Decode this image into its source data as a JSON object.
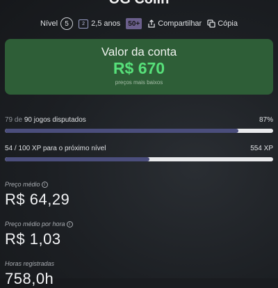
{
  "profile": {
    "name": "OG Colin",
    "level_label": "Nível",
    "level_value": "5",
    "years_icon_text": "2",
    "years": "2,5 anos",
    "badge": "50+",
    "share_label": "Compartilhar",
    "copy_label": "Cópia"
  },
  "account_value": {
    "title": "Valor da conta",
    "amount": "R$ 670",
    "subtitle": "preços mais baixos",
    "colors": {
      "card": "#2e5e37",
      "amount": "#57e07a"
    }
  },
  "games_progress": {
    "played": "79",
    "of_label": "de",
    "total": "90",
    "suffix": "jogos disputados",
    "percent_label": "87%",
    "fraction": 0.87
  },
  "xp_progress": {
    "label": "54 / 100 XP para o próximo nível",
    "right_label": "554 XP",
    "fraction": 0.54
  },
  "stats": {
    "avg_price_label": "Preço médio",
    "avg_price_value": "R$ 64,29",
    "avg_hour_label": "Preço médio por hora",
    "avg_hour_value": "R$ 1,03",
    "hours_label": "Horas registradas",
    "hours_value": "758,0h"
  },
  "icons": {
    "share": "share-icon",
    "copy": "copy-icon",
    "info": "info-icon"
  }
}
